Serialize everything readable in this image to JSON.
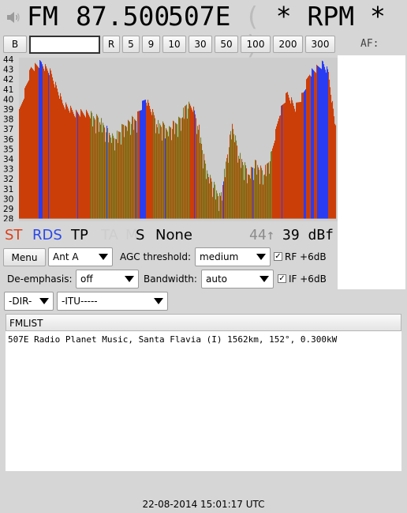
{
  "header": {
    "mode": "FM",
    "frequency": "87.500",
    "pi_code": "507E",
    "ps_open": "(",
    "ps_name": "* RPM *",
    "ps_close": ")"
  },
  "toolbar": {
    "buttons": [
      "B",
      "R",
      "5",
      "9",
      "10",
      "30",
      "50",
      "100",
      "200",
      "300"
    ],
    "freq_input_value": "",
    "af_label": "AF:"
  },
  "spectrum": {
    "y_ticks": [
      "44",
      "43",
      "42",
      "41",
      "40",
      "39",
      "38",
      "37",
      "36",
      "35",
      "34",
      "33",
      "32",
      "31",
      "30",
      "29",
      "28"
    ],
    "ylim": [
      28,
      44
    ],
    "colors": {
      "strong": "#cc3e08",
      "weak": "#7a7c22",
      "marker": "#2a3cf2",
      "background": "#cdcdcd"
    }
  },
  "status": {
    "st": "ST",
    "rds": "RDS",
    "tp": "TP",
    "ta": "TA",
    "ms_m": "M",
    "ms_s": "S",
    "pty": "None",
    "signal_peak": "44↑",
    "signal_current": "39 dBf",
    "colors": {
      "st": "#d8421a",
      "rds": "#2b48e8",
      "inactive": "#cdcdcd"
    }
  },
  "controls": {
    "menu_label": "Menu",
    "antenna_value": "Ant A",
    "agc_label": "AGC threshold:",
    "agc_value": "medium",
    "rf_label": "RF +6dB",
    "deemphasis_label": "De-emphasis:",
    "deemphasis_value": "off",
    "bandwidth_label": "Bandwidth:",
    "bandwidth_value": "auto",
    "if_label": "IF +6dB",
    "dir_value": "-DIR-",
    "itu_value": "-ITU-----"
  },
  "fmlist": {
    "title": "FMLIST",
    "entry": "507E Radio Planet Music, Santa Flavia (I) 1562km, 152°, 0.300kW"
  },
  "footer": {
    "datetime": "22-08-2014 15:01:17 UTC"
  }
}
